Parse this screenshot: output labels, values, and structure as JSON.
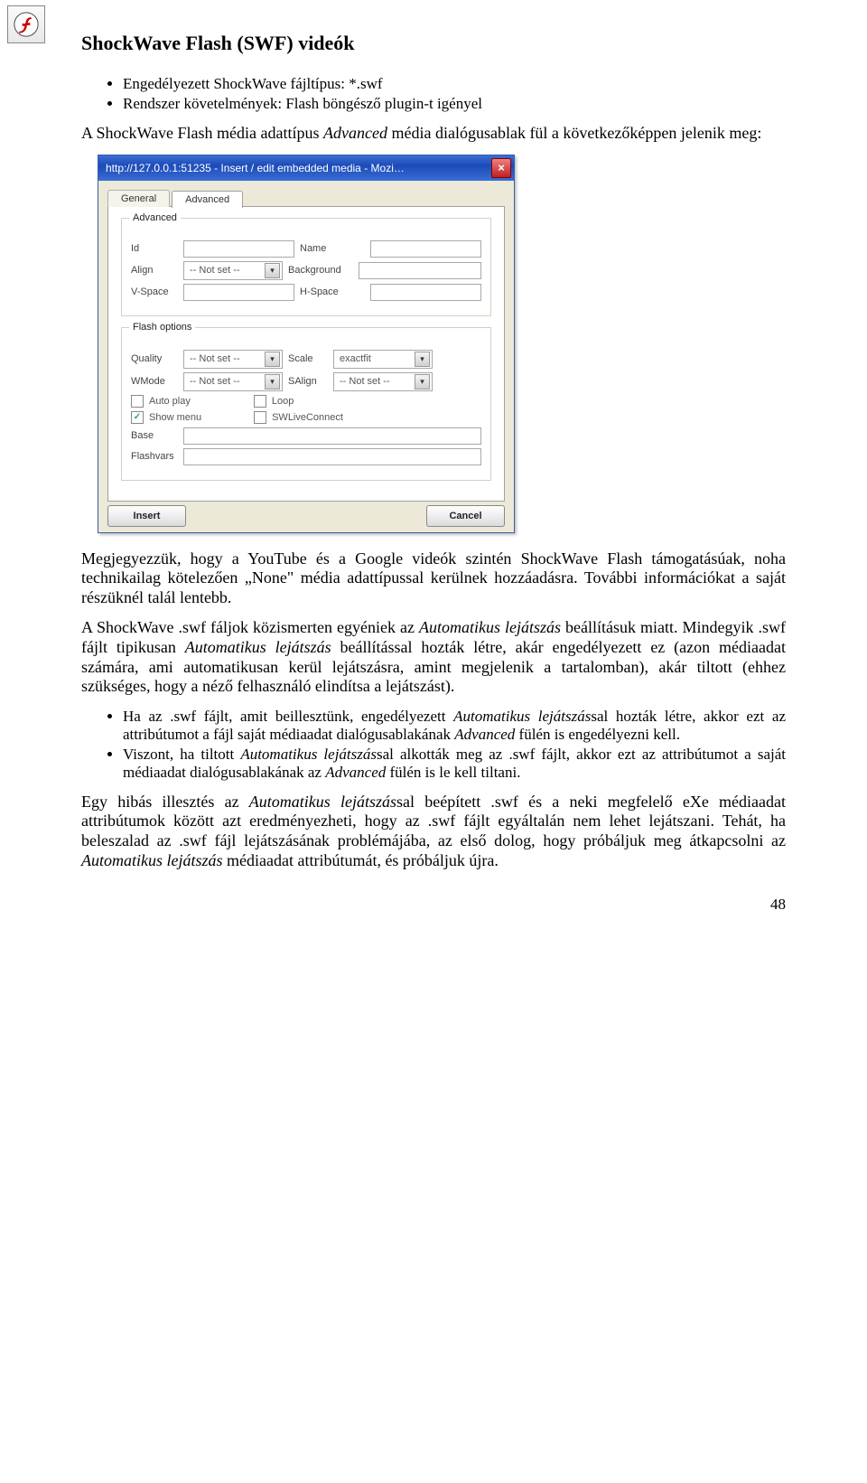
{
  "icon_name": "flash-icon",
  "title": "ShockWave Flash (SWF) videók",
  "bullets": [
    "Engedélyezett ShockWave fájltípus: *.swf",
    "Rendszer követelmények: Flash böngésző plugin-t igényel"
  ],
  "intro_pre": "A ShockWave Flash média adattípus ",
  "intro_em": "Advanced",
  "intro_post": " média dialógusablak fül a következőképpen jelenik meg:",
  "dialog": {
    "titlebar": "http://127.0.0.1:51235 - Insert / edit embedded media - Mozi…",
    "tabs": {
      "general": "General",
      "advanced": "Advanced"
    },
    "adv_legend": "Advanced",
    "labels": {
      "id": "Id",
      "name": "Name",
      "align": "Align",
      "bg": "Background",
      "vspace": "V-Space",
      "hspace": "H-Space"
    },
    "notset": "-- Not set --",
    "flash_legend": "Flash options",
    "flash_labels": {
      "quality": "Quality",
      "scale": "Scale",
      "wmode": "WMode",
      "salign": "SAlign",
      "autoplay": "Auto play",
      "loop": "Loop",
      "showmenu": "Show menu",
      "live": "SWLiveConnect",
      "base": "Base",
      "flashvars": "Flashvars"
    },
    "scale_value": "exactfit",
    "buttons": {
      "insert": "Insert",
      "cancel": "Cancel"
    }
  },
  "note_para": "Megjegyezzük, hogy a YouTube és a Google videók szintén ShockWave Flash támogatásúak, noha technikailag kötelezően „None\" média adattípussal kerülnek hozzáadásra. További információkat a saját részüknél talál lentebb.",
  "p2_a": "A ShockWave .swf fáljok közismerten egyéniek az ",
  "p2_em1": "Automatikus lejátszás",
  "p2_b": " beállításuk miatt. Mindegyik .swf fájlt tipikusan ",
  "p2_em2": "Automatikus lejátszás",
  "p2_c": " beállítással hozták létre, akár engedélyezett ez (azon médiaadat számára, ami automatikusan kerül lejátszásra, amint megjelenik a tartalomban), akár tiltott (ehhez szükséges, hogy a néző felhasználó elindítsa a lejátszást).",
  "list2_1a": "Ha az .swf fájlt, amit beillesztünk, engedélyezett ",
  "list2_1em1": "Automatikus lejátszás",
  "list2_1b": "sal hozták létre, akkor ezt az attribútumot a fájl saját médiaadat dialógusablakának ",
  "list2_1em2": "Advanced",
  "list2_1c": " fülén is engedélyezni kell.",
  "list2_2a": "Viszont, ha tiltott ",
  "list2_2em1": "Automatikus lejátszás",
  "list2_2b": "sal alkották meg az .swf fájlt, akkor ezt az attribútumot a saját médiaadat dialógusablakának az ",
  "list2_2em2": "Advanced",
  "list2_2c": " fülén is le kell tiltani.",
  "p3_a": "Egy hibás illesztés az ",
  "p3_em1": "Automatikus lejátszás",
  "p3_b": "sal beépített .swf és a neki megfelelő eXe médiaadat attribútumok között azt eredményezheti, hogy az .swf fájlt egyáltalán nem lehet lejátszani. Tehát, ha beleszalad az .swf fájl lejátszásának problémájába, az első dolog, hogy próbáljuk meg átkapcsolni az ",
  "p3_em2": "Automatikus lejátszás",
  "p3_c": " médiaadat attribútumát, és próbáljuk újra.",
  "page_number": "48"
}
